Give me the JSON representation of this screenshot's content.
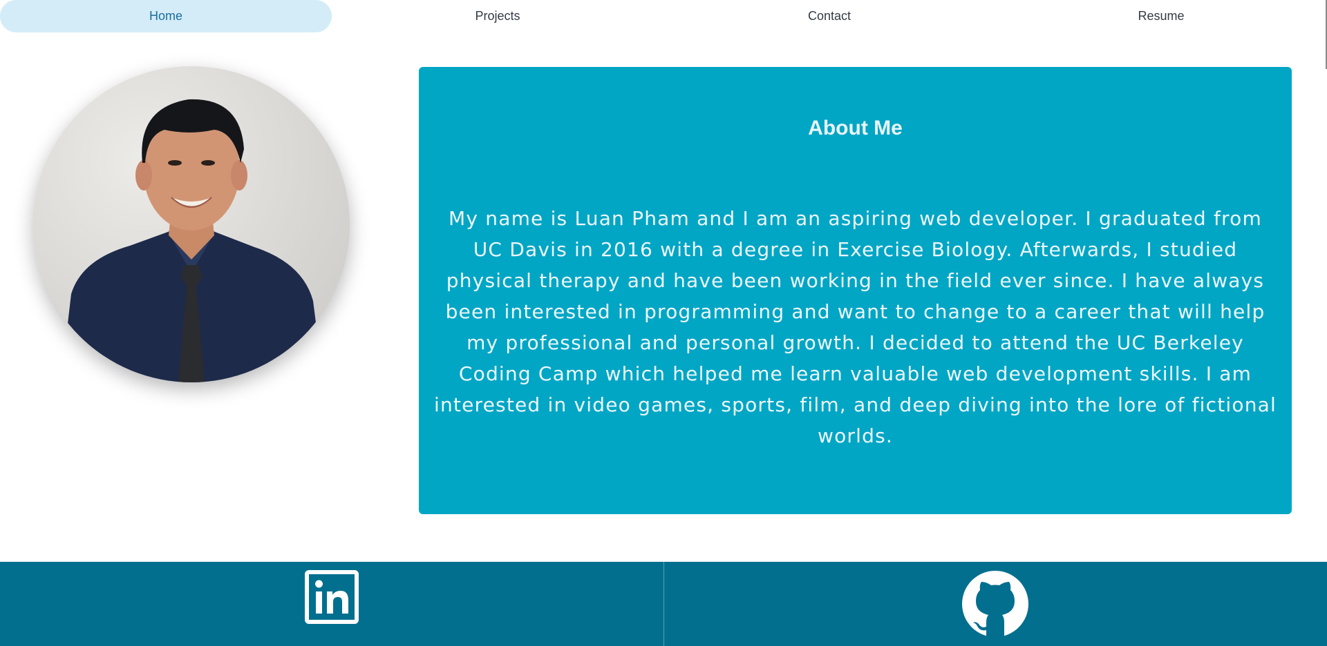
{
  "nav": {
    "items": [
      {
        "label": "Home",
        "active": true
      },
      {
        "label": "Projects",
        "active": false
      },
      {
        "label": "Contact",
        "active": false
      },
      {
        "label": "Resume",
        "active": false
      }
    ]
  },
  "profile": {
    "photo_alt": "Portrait photo of Luan Pham"
  },
  "about": {
    "title": "About Me",
    "body": "My name is Luan Pham and I am an aspiring web developer. I graduated from UC Davis in 2016 with a degree in Exercise Biology. Afterwards, I studied physical therapy and have been working in the field ever since. I have always been interested in programming and want to change to a career that will help my professional and personal growth. I decided to attend the UC Berkeley Coding Camp which helped me learn valuable web development skills. I am interested in video games, sports, film, and deep diving into the lore of fictional worlds."
  },
  "footer": {
    "links": [
      {
        "icon": "linkedin-icon"
      },
      {
        "icon": "github-icon"
      }
    ]
  },
  "colors": {
    "nav_active_bg": "#d3ecf8",
    "about_bg": "#02a6c5",
    "footer_bg": "#026f8e"
  }
}
